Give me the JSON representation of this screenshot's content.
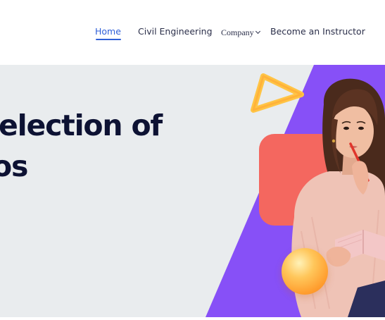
{
  "nav": {
    "home": "Home",
    "civil_engineering": "Civil Engineering",
    "company": "Company",
    "become_instructor": "Become an Instructor"
  },
  "hero": {
    "heading_line1": "election of",
    "heading_line2": "os"
  },
  "colors": {
    "accent": "#2f5fd8",
    "hero_bg": "#e9ecee",
    "purple": "#8750f7",
    "coral": "#f4675f",
    "heading": "#0d1233"
  },
  "icons": {
    "company_dropdown": "chevron-down-icon",
    "decor_triangle": "triangle-shape",
    "decor_orb": "orb-shape"
  }
}
